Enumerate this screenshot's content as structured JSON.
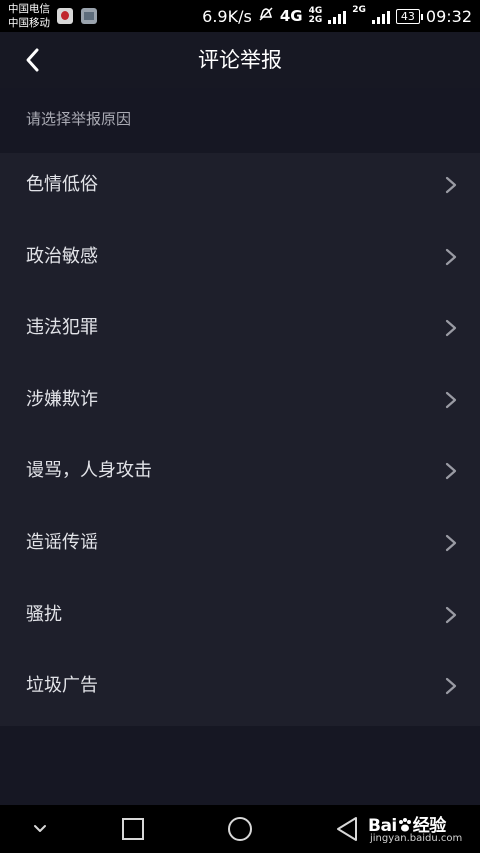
{
  "status_bar": {
    "carrier_1": "中国电信",
    "carrier_2": "中国移动",
    "speed": "6.9K/s",
    "net_4g": "4G",
    "net_small_top": "4G",
    "net_small_bottom": "2G",
    "net_2g": "2G",
    "battery": "43",
    "time": "09:32"
  },
  "header": {
    "title": "评论举报"
  },
  "section_label": "请选择举报原因",
  "reasons": [
    {
      "label": "色情低俗"
    },
    {
      "label": "政治敏感"
    },
    {
      "label": "违法犯罪"
    },
    {
      "label": "涉嫌欺诈"
    },
    {
      "label": "谩骂，人身攻击"
    },
    {
      "label": "造谣传谣"
    },
    {
      "label": "骚扰"
    },
    {
      "label": "垃圾广告"
    }
  ],
  "watermark": {
    "brand": "Bai",
    "brand_cn": "经验",
    "url": "jingyan.baidu.com"
  }
}
